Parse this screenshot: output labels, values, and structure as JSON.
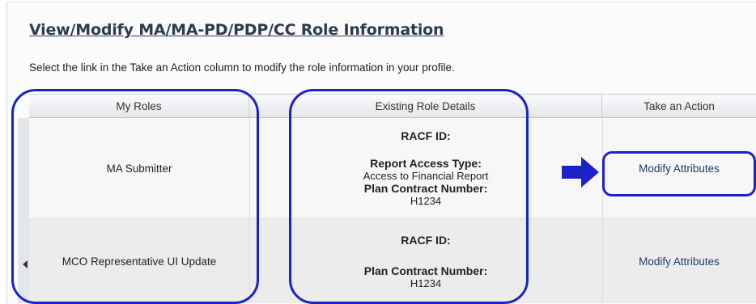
{
  "page": {
    "title": "View/Modify MA/MA-PD/PDP/CC Role Information",
    "instructions": "Select the link in the Take an Action column to modify the role information in your profile."
  },
  "table": {
    "headers": [
      "My Roles",
      "Existing Role Details",
      "Take an Action"
    ],
    "rows": [
      {
        "role": "MA Submitter",
        "racf_label": "RACF ID:",
        "report_access_label": "Report Access Type:",
        "report_access_value": "Access to Financial Report",
        "plan_label": "Plan Contract Number:",
        "plan_value": "H1234",
        "action": "Modify Attributes"
      },
      {
        "role": "MCO Representative UI Update",
        "racf_label": "RACF ID:",
        "plan_label": "Plan Contract Number:",
        "plan_value": "H1234",
        "action": "Modify Attributes"
      }
    ]
  },
  "annotations": {
    "highlight_color": "#1a22c8",
    "arrow": "right-arrow-icon"
  }
}
